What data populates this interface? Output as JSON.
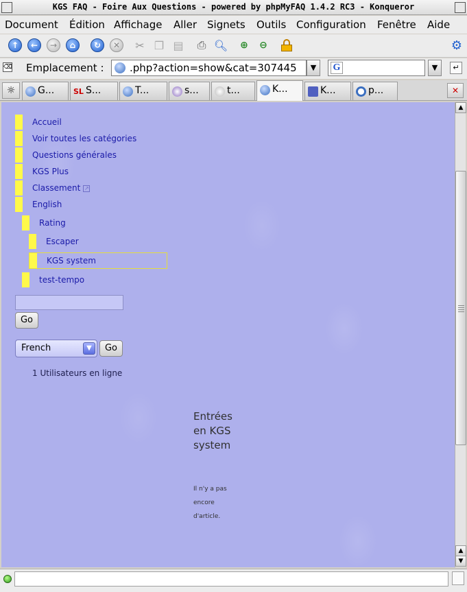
{
  "window": {
    "title": "KGS FAQ - Foire Aux Questions - powered by phpMyFAQ 1.4.2 RC3 - Konqueror"
  },
  "menubar": [
    "Document",
    "Édition",
    "Affichage",
    "Aller",
    "Signets",
    "Outils",
    "Configuration",
    "Fenêtre",
    "Aide"
  ],
  "location": {
    "label": "Emplacement :",
    "url": ".php?action=show&cat=307445"
  },
  "tabs": [
    {
      "label": "G..."
    },
    {
      "label": "S..."
    },
    {
      "label": "T..."
    },
    {
      "label": "s..."
    },
    {
      "label": "t..."
    },
    {
      "label": "K..."
    },
    {
      "label": "K..."
    },
    {
      "label": "p..."
    }
  ],
  "nav": {
    "accueil": "Accueil",
    "all_categories": "Voir toutes les catégories",
    "general": "Questions générales",
    "kgs_plus": "KGS Plus",
    "classement": "Classement",
    "english": "English",
    "rating": "Rating",
    "escaper": "Escaper",
    "kgs_system": "KGS system",
    "test_tempo": "test-tempo"
  },
  "search": {
    "value": "",
    "go_label": "Go"
  },
  "language": {
    "selected": "French",
    "go_label": "Go"
  },
  "online_users": "1 Utilisateurs en ligne",
  "main": {
    "title": "Entrées en KGS system",
    "empty_message": "Il n'y a pas encore d'article."
  }
}
